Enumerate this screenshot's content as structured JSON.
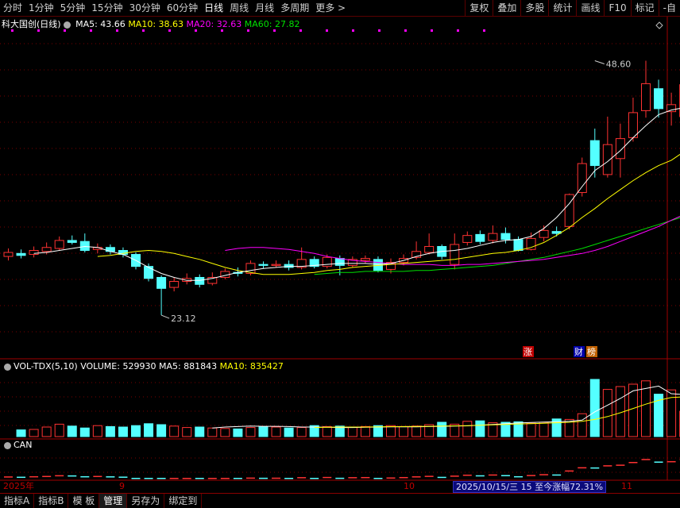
{
  "toolbar": {
    "periods": [
      "分时",
      "1分钟",
      "5分钟",
      "15分钟",
      "30分钟",
      "60分钟",
      "日线",
      "周线",
      "月线",
      "多周期",
      "更多 >"
    ],
    "active_period": "日线",
    "right_buttons": [
      "复权",
      "叠加",
      "多股",
      "统计",
      "画线",
      "F10",
      "标记",
      "-自"
    ]
  },
  "main_legend": {
    "title": "科大国创(日线)",
    "ma5": "MA5: 43.66",
    "ma10": "MA10: 38.63",
    "ma20": "MA20: 32.63",
    "ma60": "MA60: 27.82",
    "high_label": "48.60",
    "low_label": "23.12",
    "tag_zhang": "涨",
    "tag_cai": "财",
    "tag_bang": "榜"
  },
  "vol_legend": {
    "name": "VOL-TDX(5,10)",
    "volume": "VOLUME: 529930",
    "ma5": "MA5: 881843",
    "ma10": "MA10: 835427"
  },
  "can_legend": {
    "name": "CAN"
  },
  "datebar": {
    "labels": [
      "2025年",
      "9",
      "10",
      "11"
    ],
    "info": "2025/10/15/三 15 至今涨幅72.31%"
  },
  "statusbar": {
    "tabs": [
      "指标A",
      "指标B",
      "模 板",
      "管理",
      "另存为",
      "绑定到"
    ],
    "active_tab": "管理"
  },
  "colors": {
    "up": "#ff3232",
    "down": "#54ffff",
    "ma5": "#ffffff",
    "ma10": "#ffff00",
    "ma20": "#ff00ff",
    "ma60": "#00e000",
    "grid": "#7a0000"
  },
  "chart_data": {
    "type": "candlestick",
    "title": "科大国创(日线)",
    "price_range": [
      20.5,
      51.5
    ],
    "candles": [
      {
        "o": 29.0,
        "c": 29.4,
        "h": 29.8,
        "l": 28.6
      },
      {
        "o": 29.3,
        "c": 29.1,
        "h": 29.7,
        "l": 28.8
      },
      {
        "o": 29.2,
        "c": 29.6,
        "h": 30.0,
        "l": 28.9
      },
      {
        "o": 29.5,
        "c": 29.9,
        "h": 30.4,
        "l": 29.2
      },
      {
        "o": 29.8,
        "c": 30.6,
        "h": 31.0,
        "l": 29.6
      },
      {
        "o": 30.6,
        "c": 30.4,
        "h": 31.1,
        "l": 30.2
      },
      {
        "o": 30.5,
        "c": 29.6,
        "h": 31.3,
        "l": 29.4
      },
      {
        "o": 29.7,
        "c": 29.9,
        "h": 30.3,
        "l": 29.3
      },
      {
        "o": 29.9,
        "c": 29.5,
        "h": 30.2,
        "l": 29.2
      },
      {
        "o": 29.6,
        "c": 29.2,
        "h": 29.9,
        "l": 28.9
      },
      {
        "o": 29.2,
        "c": 28.0,
        "h": 29.4,
        "l": 27.7
      },
      {
        "o": 28.0,
        "c": 26.8,
        "h": 28.3,
        "l": 26.5
      },
      {
        "o": 26.9,
        "c": 25.8,
        "h": 27.1,
        "l": 23.12
      },
      {
        "o": 25.9,
        "c": 26.5,
        "h": 26.9,
        "l": 25.5
      },
      {
        "o": 26.5,
        "c": 26.8,
        "h": 27.3,
        "l": 26.2
      },
      {
        "o": 26.9,
        "c": 26.2,
        "h": 27.2,
        "l": 25.9
      },
      {
        "o": 26.3,
        "c": 26.9,
        "h": 27.4,
        "l": 26.1
      },
      {
        "o": 26.9,
        "c": 27.5,
        "h": 27.8,
        "l": 26.7
      },
      {
        "o": 27.4,
        "c": 27.3,
        "h": 27.9,
        "l": 27.0
      },
      {
        "o": 27.3,
        "c": 28.3,
        "h": 28.6,
        "l": 27.1
      },
      {
        "o": 28.2,
        "c": 28.1,
        "h": 28.5,
        "l": 27.8
      },
      {
        "o": 28.1,
        "c": 28.2,
        "h": 28.6,
        "l": 27.9
      },
      {
        "o": 28.2,
        "c": 27.9,
        "h": 28.6,
        "l": 27.6
      },
      {
        "o": 27.9,
        "c": 28.7,
        "h": 29.9,
        "l": 27.7
      },
      {
        "o": 28.7,
        "c": 28.0,
        "h": 29.0,
        "l": 27.8
      },
      {
        "o": 28.0,
        "c": 28.9,
        "h": 29.2,
        "l": 27.8
      },
      {
        "o": 28.8,
        "c": 28.1,
        "h": 29.1,
        "l": 27.1
      },
      {
        "o": 28.1,
        "c": 28.7,
        "h": 29.0,
        "l": 27.9
      },
      {
        "o": 28.6,
        "c": 28.8,
        "h": 29.1,
        "l": 28.3
      },
      {
        "o": 28.7,
        "c": 27.6,
        "h": 29.0,
        "l": 27.4
      },
      {
        "o": 27.7,
        "c": 28.4,
        "h": 28.8,
        "l": 27.3
      },
      {
        "o": 28.4,
        "c": 28.8,
        "h": 29.2,
        "l": 28.1
      },
      {
        "o": 28.9,
        "c": 29.5,
        "h": 30.5,
        "l": 28.7
      },
      {
        "o": 29.4,
        "c": 30.0,
        "h": 31.3,
        "l": 29.2
      },
      {
        "o": 30.0,
        "c": 29.0,
        "h": 30.2,
        "l": 28.7
      },
      {
        "o": 28.2,
        "c": 30.2,
        "h": 31.3,
        "l": 27.7
      },
      {
        "o": 30.4,
        "c": 31.1,
        "h": 31.5,
        "l": 30.1
      },
      {
        "o": 31.2,
        "c": 30.5,
        "h": 31.6,
        "l": 30.2
      },
      {
        "o": 30.6,
        "c": 31.3,
        "h": 32.1,
        "l": 30.3
      },
      {
        "o": 31.3,
        "c": 30.7,
        "h": 31.9,
        "l": 30.3
      },
      {
        "o": 30.7,
        "c": 29.6,
        "h": 31.0,
        "l": 29.5
      },
      {
        "o": 29.7,
        "c": 30.8,
        "h": 31.4,
        "l": 29.6
      },
      {
        "o": 30.9,
        "c": 31.6,
        "h": 32.1,
        "l": 30.5
      },
      {
        "o": 31.5,
        "c": 31.3,
        "h": 32.0,
        "l": 31.0
      },
      {
        "o": 32.0,
        "c": 35.2,
        "h": 35.3,
        "l": 31.7
      },
      {
        "o": 35.4,
        "c": 38.3,
        "h": 38.9,
        "l": 35.0
      },
      {
        "o": 40.6,
        "c": 38.1,
        "h": 41.8,
        "l": 36.9
      },
      {
        "o": 37.2,
        "c": 40.2,
        "h": 43.0,
        "l": 36.9
      },
      {
        "o": 38.8,
        "c": 40.8,
        "h": 42.3,
        "l": 36.9
      },
      {
        "o": 40.9,
        "c": 43.4,
        "h": 44.9,
        "l": 40.5
      },
      {
        "o": 43.6,
        "c": 46.3,
        "h": 48.6,
        "l": 42.9
      },
      {
        "o": 45.8,
        "c": 43.8,
        "h": 46.7,
        "l": 42.9
      },
      {
        "o": 43.5,
        "c": 44.2,
        "h": 45.4,
        "l": 42.1
      },
      {
        "o": 43.0,
        "c": 46.2,
        "h": 46.4,
        "l": 42.6
      }
    ],
    "ma5": [
      29.3,
      29.4,
      29.6,
      29.8,
      30.0,
      29.9,
      29.5,
      29.2,
      28.6,
      27.9,
      27.3,
      26.9,
      26.6,
      26.6,
      26.8,
      27.1,
      27.4,
      27.6,
      27.8,
      27.9,
      28.0,
      28.0,
      28.1,
      28.2,
      28.3,
      28.3,
      28.3,
      28.2,
      28.3,
      28.6,
      29.0,
      29.3,
      29.5,
      29.6,
      29.8,
      30.1,
      30.4,
      30.6,
      30.7,
      31.0,
      31.8,
      32.9,
      34.3,
      36.0,
      37.6,
      38.5,
      39.6,
      40.9,
      42.1,
      43.2,
      43.66,
      43.9
    ],
    "ma10": [
      29.0,
      29.1,
      29.3,
      29.5,
      29.6,
      29.5,
      29.3,
      29.0,
      28.7,
      28.3,
      27.9,
      27.6,
      27.4,
      27.2,
      27.2,
      27.2,
      27.3,
      27.4,
      27.6,
      27.7,
      27.9,
      28.0,
      28.1,
      28.2,
      28.3,
      28.4,
      28.5,
      28.6,
      28.7,
      28.9,
      29.1,
      29.3,
      29.4,
      29.6,
      29.9,
      30.4,
      31.1,
      31.9,
      32.9,
      33.8,
      34.8,
      35.7,
      36.6,
      37.4,
      38.1,
      38.63,
      39.5
    ],
    "ma20": [
      29.6,
      29.8,
      29.9,
      29.9,
      29.8,
      29.7,
      29.5,
      29.3,
      29.0,
      28.8,
      28.6,
      28.5,
      28.4,
      28.3,
      28.2,
      28.2,
      28.2,
      28.1,
      28.1,
      28.2,
      28.2,
      28.3,
      28.4,
      28.5,
      28.6,
      28.7,
      28.9,
      29.1,
      29.3,
      29.6,
      30.0,
      30.5,
      31.0,
      31.5,
      32.0,
      32.63,
      33.2
    ],
    "ma60": [
      27.2,
      27.3,
      27.4,
      27.4,
      27.5,
      27.5,
      27.5,
      27.5,
      27.6,
      27.6,
      27.7,
      27.8,
      27.9,
      28.0,
      28.1,
      28.3,
      28.5,
      28.7,
      28.9,
      29.2,
      29.5,
      29.8,
      30.2,
      30.6,
      31.0,
      31.4,
      31.8,
      32.2,
      32.6,
      33.0
    ],
    "volume_max": 1300000,
    "volume": [
      140000,
      150000,
      200000,
      260000,
      220000,
      180000,
      230000,
      210000,
      200000,
      230000,
      270000,
      250000,
      220000,
      190000,
      200000,
      180000,
      170000,
      160000,
      190000,
      210000,
      200000,
      180000,
      190000,
      230000,
      210000,
      220000,
      200000,
      210000,
      230000,
      230000,
      210000,
      220000,
      250000,
      300000,
      260000,
      320000,
      330000,
      290000,
      300000,
      310000,
      280000,
      300000,
      370000,
      360000,
      480000,
      1200000,
      990000,
      1050000,
      1100000,
      1170000,
      890000,
      980000,
      529930
    ],
    "vol_ma5": [
      180000,
      200000,
      210000,
      220000,
      215000,
      215000,
      210000,
      200000,
      200000,
      195000,
      190000,
      190000,
      195000,
      200000,
      205000,
      205000,
      205000,
      210000,
      215000,
      220000,
      225000,
      240000,
      255000,
      270000,
      285000,
      295000,
      305000,
      310000,
      320000,
      345000,
      520000,
      660000,
      800000,
      960000,
      1010000,
      1060000,
      900000,
      881843
    ],
    "vol_ma10": [
      190000,
      195000,
      200000,
      200000,
      200000,
      205000,
      208000,
      210000,
      212000,
      215000,
      220000,
      225000,
      230000,
      238000,
      246000,
      255000,
      265000,
      272000,
      280000,
      290000,
      300000,
      320000,
      360000,
      420000,
      500000,
      590000,
      680000,
      760000,
      820000,
      835427
    ]
  }
}
